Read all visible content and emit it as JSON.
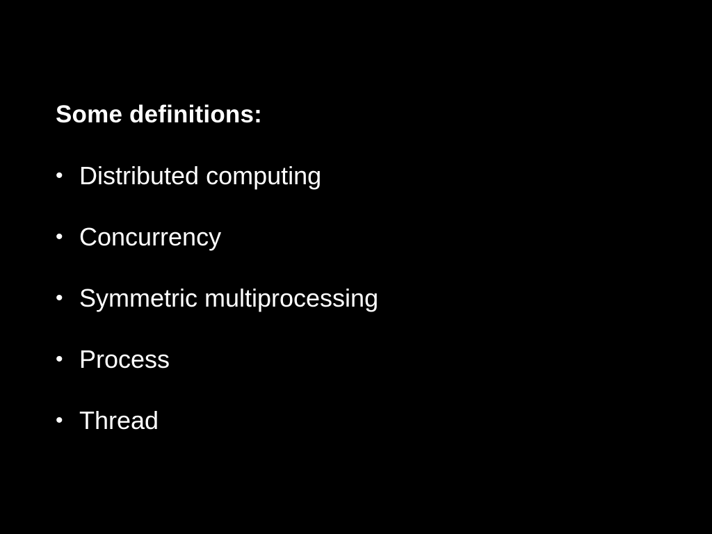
{
  "slide": {
    "heading": "Some definitions:",
    "bullet_symbol": "•",
    "items": [
      {
        "label": "Distributed computing"
      },
      {
        "label": "Concurrency"
      },
      {
        "label": "Symmetric multiprocessing"
      },
      {
        "label": "Process"
      },
      {
        "label": "Thread"
      }
    ]
  },
  "colors": {
    "background": "#000000",
    "text": "#ffffff"
  }
}
